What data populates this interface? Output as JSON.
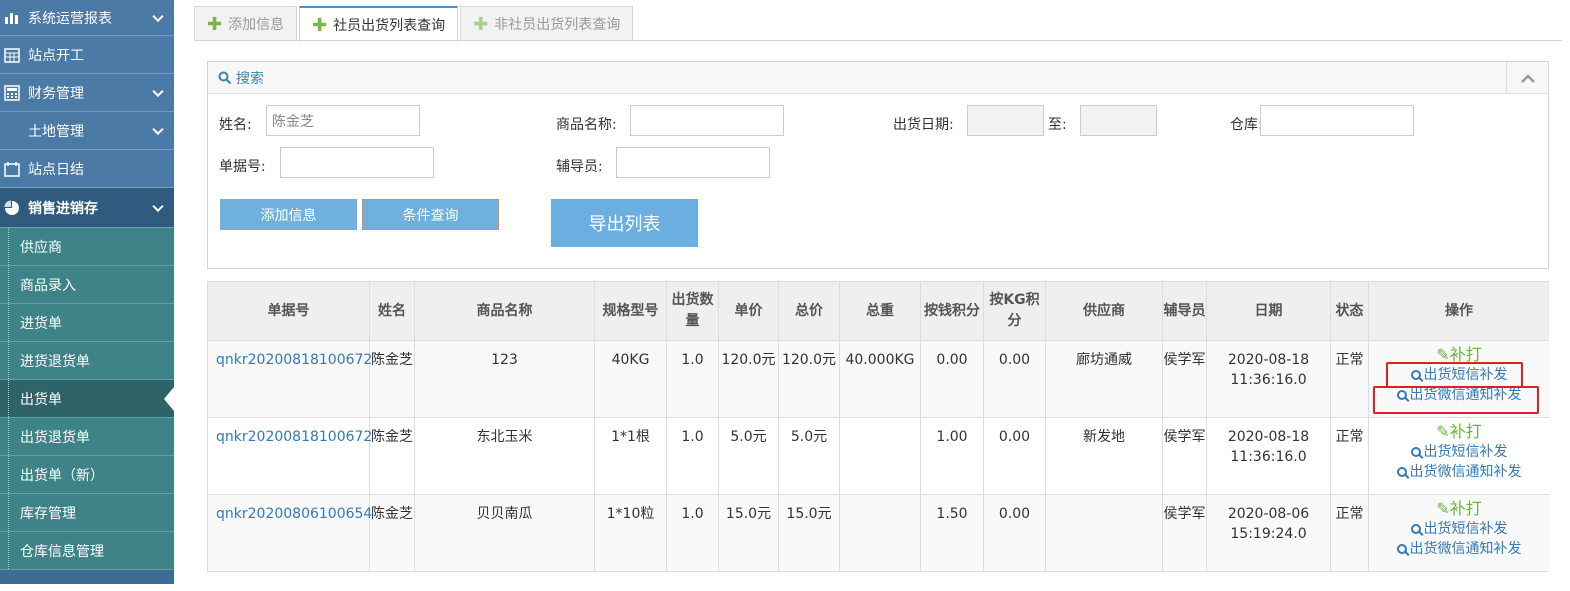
{
  "sidebar": {
    "top_items": [
      {
        "label": "系统运营报表",
        "icon": "bar-chart-icon",
        "has_chevron": true
      },
      {
        "label": "站点开工",
        "icon": "calendar-grid-icon",
        "has_chevron": false
      },
      {
        "label": "财务管理",
        "icon": "calculator-icon",
        "has_chevron": true
      },
      {
        "label": "土地管理",
        "icon": "",
        "has_chevron": true
      },
      {
        "label": "站点日结",
        "icon": "calendar-icon",
        "has_chevron": false
      },
      {
        "label": "销售进销存",
        "icon": "pie-chart-icon",
        "has_chevron": true,
        "active": true
      }
    ],
    "sub_items": [
      {
        "label": "供应商"
      },
      {
        "label": "商品录入"
      },
      {
        "label": "进货单"
      },
      {
        "label": "进货退货单"
      },
      {
        "label": "出货单",
        "active": true
      },
      {
        "label": "出货退货单"
      },
      {
        "label": "出货单（新）"
      },
      {
        "label": "库存管理"
      },
      {
        "label": "仓库信息管理"
      }
    ]
  },
  "tabs": [
    {
      "label": "添加信息",
      "active": false
    },
    {
      "label": "社员出货列表查询",
      "active": true
    },
    {
      "label": "非社员出货列表查询",
      "active": false
    }
  ],
  "search": {
    "title": "搜索",
    "name_label": "姓名:",
    "name_value": "陈金芝",
    "product_label": "商品名称:",
    "product_value": "",
    "date_label": "出货日期:",
    "date_to_label": "至:",
    "warehouse_label": "仓库:",
    "bill_label": "单据号:",
    "assistant_label": "辅导员:",
    "add_button": "添加信息",
    "query_button": "条件查询",
    "export_button": "导出列表"
  },
  "table": {
    "headers": [
      "单据号",
      "姓名",
      "商品名称",
      "规格型号",
      "出货数量",
      "单价",
      "总价",
      "总重",
      "按钱积分",
      "按KG积分",
      "供应商",
      "辅导员",
      "日期",
      "状态",
      "操作"
    ],
    "rows": [
      {
        "code": "qnkr20200818100672",
        "name": "陈金芝",
        "product": "123",
        "spec": "40KG",
        "qty": "1.0",
        "unit_price": "120.0元",
        "total": "120.0元",
        "weight": "40.000KG",
        "money_points": "0.00",
        "kg_points": "0.00",
        "supplier": "廊坊通威",
        "assistant": "侯学军",
        "date": "2020-08-18 11:36:16.0",
        "status": "正常"
      },
      {
        "code": "qnkr20200818100672",
        "name": "陈金芝",
        "product": "东北玉米",
        "spec": "1*1根",
        "qty": "1.0",
        "unit_price": "5.0元",
        "total": "5.0元",
        "weight": "",
        "money_points": "1.00",
        "kg_points": "0.00",
        "supplier": "新发地",
        "assistant": "侯学军",
        "date": "2020-08-18 11:36:16.0",
        "status": "正常"
      },
      {
        "code": "qnkr20200806100654",
        "name": "陈金芝",
        "product": "贝贝南瓜",
        "spec": "1*10粒",
        "qty": "1.0",
        "unit_price": "15.0元",
        "total": "15.0元",
        "weight": "",
        "money_points": "1.50",
        "kg_points": "0.00",
        "supplier": "",
        "assistant": "侯学军",
        "date": "2020-08-06 15:19:24.0",
        "status": "正常"
      }
    ],
    "actions": {
      "edit": "补打",
      "sms": "出货短信补发",
      "wechat": "出货微信通知补发"
    }
  },
  "colors": {
    "sidebar_top": "#4a7aa5",
    "sidebar_sub": "#3e8387",
    "link": "#337ab7",
    "edit": "#6db33f",
    "highlight": "#e02020"
  }
}
